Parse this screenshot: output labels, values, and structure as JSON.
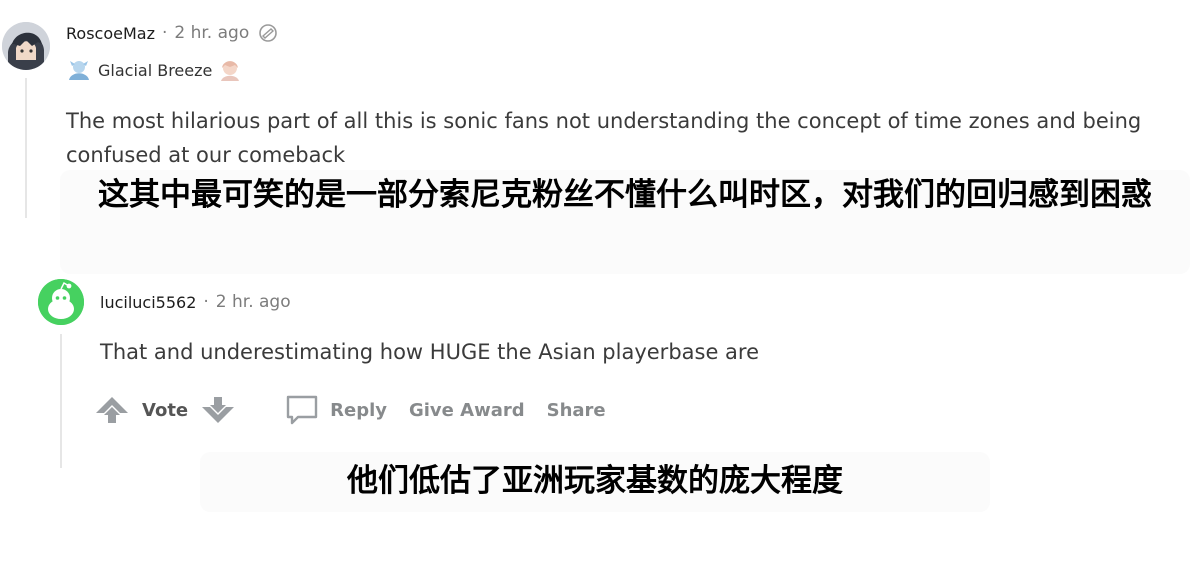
{
  "comment1": {
    "username": "RoscoeMaz",
    "separator": "·",
    "age": "2 hr. ago",
    "flair": "Glacial Breeze",
    "body": "The most hilarious part of all this is sonic fans not understanding the concept of time zones and being confused at our comeback"
  },
  "subtitle1": "这其中最可笑的是一部分索尼克粉丝不懂什么叫时区，对我们的回归感到困惑",
  "comment2": {
    "username": "luciluci5562",
    "separator": "·",
    "age": "2 hr. ago",
    "body": "That and underestimating how HUGE the Asian playerbase are"
  },
  "actions": {
    "vote_label": "Vote",
    "reply_label": "Reply",
    "award_label": "Give Award",
    "share_label": "Share"
  },
  "subtitle2": "他们低估了亚洲玩家基数的庞大程度",
  "icons": {
    "avatar2": "reddit-snoo-avatar",
    "upvote": "upvote-arrow-icon",
    "downvote": "downvote-arrow-icon",
    "reply": "speech-bubble-icon"
  },
  "colors": {
    "avatar2_bg": "#46d160",
    "muted_text": "#878a8c",
    "body_text": "#3b3b3b"
  }
}
